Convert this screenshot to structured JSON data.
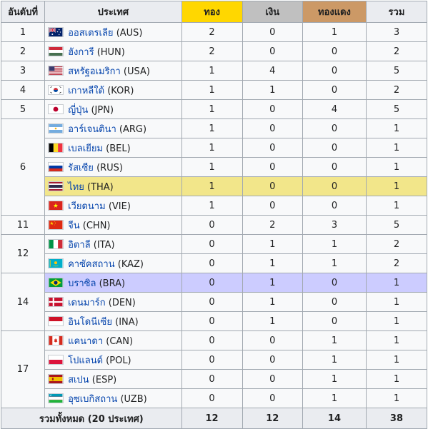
{
  "header": {
    "rank": "อันดับที่",
    "nation": "ประเทศ",
    "gold": "ทอง",
    "silver": "เงิน",
    "bronze": "ทองแดง",
    "total": "รวม"
  },
  "rows": [
    {
      "rank": "1",
      "name": "ออสเตรเลีย",
      "code": "(AUS)",
      "flag": "australia-flag-icon",
      "gold": "2",
      "silver": "0",
      "bronze": "1",
      "total": "3"
    },
    {
      "rank": "2",
      "name": "ฮังการี",
      "code": "(HUN)",
      "flag": "hungary-flag-icon",
      "gold": "2",
      "silver": "0",
      "bronze": "0",
      "total": "2"
    },
    {
      "rank": "3",
      "name": "สหรัฐอเมริกา",
      "code": "(USA)",
      "flag": "usa-flag-icon",
      "gold": "1",
      "silver": "4",
      "bronze": "0",
      "total": "5"
    },
    {
      "rank": "4",
      "name": "เกาหลีใต้",
      "code": "(KOR)",
      "flag": "south-korea-flag-icon",
      "gold": "1",
      "silver": "1",
      "bronze": "0",
      "total": "2"
    },
    {
      "rank": "5",
      "name": "ญี่ปุ่น",
      "code": "(JPN)",
      "flag": "japan-flag-icon",
      "gold": "1",
      "silver": "0",
      "bronze": "4",
      "total": "5"
    },
    {
      "rank": "6",
      "name": "อาร์เจนตินา",
      "code": "(ARG)",
      "flag": "argentina-flag-icon",
      "gold": "1",
      "silver": "0",
      "bronze": "0",
      "total": "1"
    },
    {
      "rank": "",
      "name": "เบลเยียม",
      "code": "(BEL)",
      "flag": "belgium-flag-icon",
      "gold": "1",
      "silver": "0",
      "bronze": "0",
      "total": "1"
    },
    {
      "rank": "",
      "name": "รัสเซีย",
      "code": "(RUS)",
      "flag": "russia-flag-icon",
      "gold": "1",
      "silver": "0",
      "bronze": "0",
      "total": "1"
    },
    {
      "rank": "",
      "name": "ไทย",
      "code": "(THA)",
      "flag": "thailand-flag-icon",
      "gold": "1",
      "silver": "0",
      "bronze": "0",
      "total": "1"
    },
    {
      "rank": "",
      "name": "เวียดนาม",
      "code": "(VIE)",
      "flag": "vietnam-flag-icon",
      "gold": "1",
      "silver": "0",
      "bronze": "0",
      "total": "1"
    },
    {
      "rank": "11",
      "name": "จีน",
      "code": "(CHN)",
      "flag": "china-flag-icon",
      "gold": "0",
      "silver": "2",
      "bronze": "3",
      "total": "5"
    },
    {
      "rank": "12",
      "name": "อิตาลี",
      "code": "(ITA)",
      "flag": "italy-flag-icon",
      "gold": "0",
      "silver": "1",
      "bronze": "1",
      "total": "2"
    },
    {
      "rank": "",
      "name": "คาซัคสถาน",
      "code": "(KAZ)",
      "flag": "kazakhstan-flag-icon",
      "gold": "0",
      "silver": "1",
      "bronze": "1",
      "total": "2"
    },
    {
      "rank": "14",
      "name": "บราซิล",
      "code": "(BRA)",
      "flag": "brazil-flag-icon",
      "gold": "0",
      "silver": "1",
      "bronze": "0",
      "total": "1"
    },
    {
      "rank": "",
      "name": "เดนมาร์ก",
      "code": "(DEN)",
      "flag": "denmark-flag-icon",
      "gold": "0",
      "silver": "1",
      "bronze": "0",
      "total": "1"
    },
    {
      "rank": "",
      "name": "อินโดนีเซีย",
      "code": "(INA)",
      "flag": "indonesia-flag-icon",
      "gold": "0",
      "silver": "1",
      "bronze": "0",
      "total": "1"
    },
    {
      "rank": "17",
      "name": "แคนาดา",
      "code": "(CAN)",
      "flag": "canada-flag-icon",
      "gold": "0",
      "silver": "0",
      "bronze": "1",
      "total": "1"
    },
    {
      "rank": "",
      "name": "โปแลนด์",
      "code": "(POL)",
      "flag": "poland-flag-icon",
      "gold": "0",
      "silver": "0",
      "bronze": "1",
      "total": "1"
    },
    {
      "rank": "",
      "name": "สเปน",
      "code": "(ESP)",
      "flag": "spain-flag-icon",
      "gold": "0",
      "silver": "0",
      "bronze": "1",
      "total": "1"
    },
    {
      "rank": "",
      "name": "อุซเบกิสถาน",
      "code": "(UZB)",
      "flag": "uzbekistan-flag-icon",
      "gold": "0",
      "silver": "0",
      "bronze": "1",
      "total": "1"
    }
  ],
  "totals": {
    "label": "รวมทั้งหมด (20 ประเทศ)",
    "gold": "12",
    "silver": "12",
    "bronze": "14",
    "total": "38"
  },
  "colors": {
    "gold_header": "#ffd700",
    "silver_header": "#c0c0c0",
    "bronze_header": "#cc9966",
    "host_highlight": "#f2e68a",
    "brazil_highlight": "#ccccff",
    "link": "#0645ad"
  }
}
